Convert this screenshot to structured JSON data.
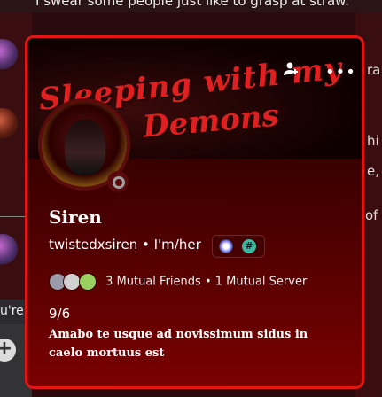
{
  "background_chat": {
    "top_text": "I swear some people just like to grasp at straw.",
    "right_fragments": [
      "ra",
      "hi",
      "e,",
      "of"
    ],
    "left_label": "u're"
  },
  "profile": {
    "banner_line1": "Sleeping with my",
    "banner_line2": "Demons",
    "display_name": "Siren",
    "username": "twistedxsiren",
    "separator": "•",
    "pronouns": "I'm/her",
    "mutual_friends": "3 Mutual Friends",
    "mutual_servers": "1 Mutual Server",
    "bio_line1": "9/6",
    "bio_line2": "Amabo te usque ad novissimum sidus in caelo mortuus est",
    "status": "idle"
  },
  "colors": {
    "accent_border": "#e31515",
    "card_bottom": "#7a0000"
  }
}
